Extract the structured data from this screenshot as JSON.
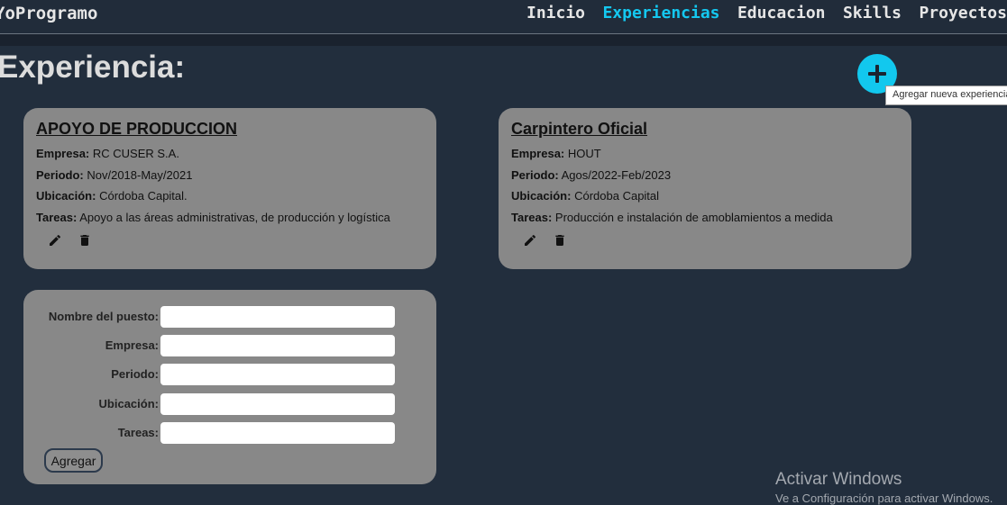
{
  "navbar": {
    "brand": "YoProgramo",
    "links": [
      {
        "label": "Inicio"
      },
      {
        "label": "Experiencias",
        "active": true
      },
      {
        "label": "Educacion"
      },
      {
        "label": "Skills"
      },
      {
        "label": "Proyectos"
      }
    ]
  },
  "page": {
    "title": "Experiencia:",
    "add_tooltip": "Agregar nueva experiencia"
  },
  "labels": {
    "empresa": "Empresa:",
    "periodo": "Periodo:",
    "ubicacion": "Ubicación:",
    "tareas": "Tareas:"
  },
  "experiences": [
    {
      "title": "APOYO DE PRODUCCION",
      "empresa": "RC CUSER S.A.",
      "periodo": "Nov/2018-May/2021",
      "ubicacion": "Córdoba Capital.",
      "tareas": "Apoyo a las áreas administrativas, de producción y logística"
    },
    {
      "title": "Carpintero Oficial",
      "empresa": "HOUT",
      "periodo": "Agos/2022-Feb/2023",
      "ubicacion": "Córdoba Capital",
      "tareas": "Producción e instalación de amoblamientos a medida"
    }
  ],
  "form": {
    "fields": [
      {
        "label": "Nombre del puesto:",
        "value": ""
      },
      {
        "label": "Empresa:",
        "value": ""
      },
      {
        "label": "Periodo:",
        "value": ""
      },
      {
        "label": "Ubicación:",
        "value": ""
      },
      {
        "label": "Tareas:",
        "value": ""
      }
    ],
    "submit_label": "Agregar"
  },
  "watermark": {
    "title": "Activar Windows",
    "subtitle": "Ve a Configuración para activar Windows."
  },
  "icons": {
    "add": "plus-icon",
    "edit": "pencil-icon",
    "delete": "trash-icon"
  },
  "colors": {
    "background": "#222e3d",
    "accent": "#14c8f0",
    "card": "#888888"
  }
}
